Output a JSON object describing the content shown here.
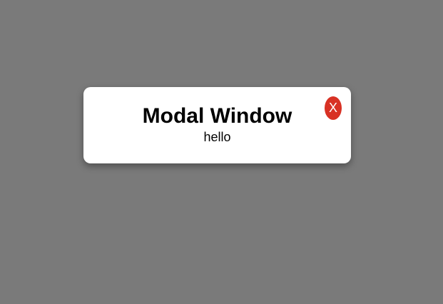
{
  "modal": {
    "title": "Modal Window",
    "body": "hello",
    "close_label": "X"
  },
  "colors": {
    "backdrop": "#7a7a7a",
    "modal_background": "#ffffff",
    "close_button": "#d83124"
  }
}
